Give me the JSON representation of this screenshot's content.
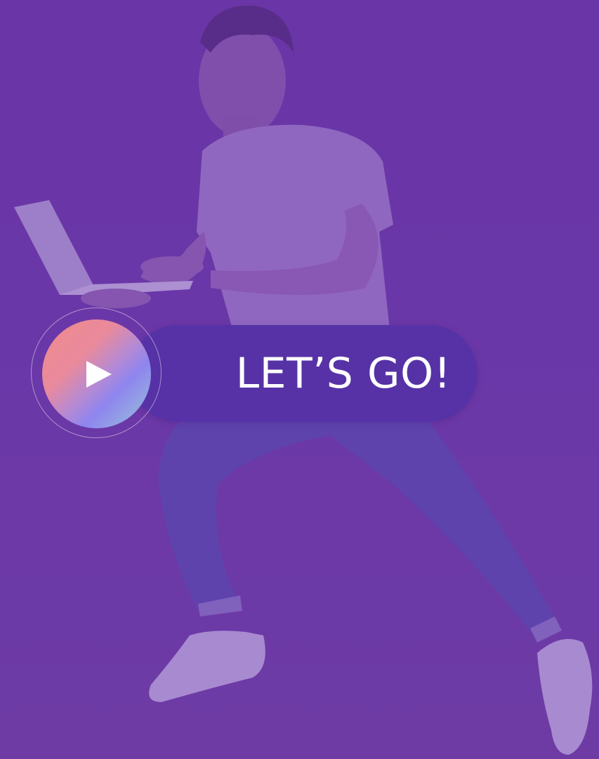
{
  "cta": {
    "label": "LET’S GO!",
    "icon": "play-icon"
  },
  "colors": {
    "background": "#6b38a8",
    "pill": "#5632a6",
    "text": "#ffffff",
    "play_gradient": [
      "#f08a8c",
      "#8e85ef",
      "#99c7d6"
    ]
  }
}
